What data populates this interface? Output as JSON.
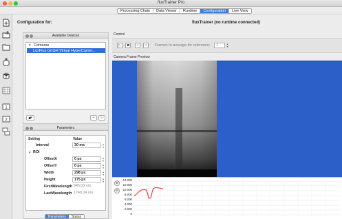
{
  "window": {
    "title": "fluxTrainer Pro"
  },
  "tabs": [
    {
      "label": "Processing Chain",
      "active": false
    },
    {
      "label": "Data Viewer",
      "active": false
    },
    {
      "label": "Runtime",
      "active": false
    },
    {
      "label": "Configuration",
      "active": true
    },
    {
      "label": "Live View",
      "active": false
    }
  ],
  "config": {
    "label": "Configuration for:",
    "connection": "fluxTrainer (no runtime connected)"
  },
  "devices_panel": {
    "title": "Available Devices",
    "tree": {
      "group": "Cameras",
      "item": "LuxFlux GmbH Virtual HyperCamer..."
    }
  },
  "parameters_panel": {
    "title": "Parameters",
    "columns": {
      "setting": "Setting",
      "value": "Value"
    },
    "rows": [
      {
        "name": "Interval",
        "value": "30 ms",
        "editable": true
      },
      {
        "name": "ROI",
        "value": "",
        "group": true
      },
      {
        "name": "OffsetX",
        "value": "0 px",
        "editable": true
      },
      {
        "name": "OffsetY",
        "value": "0 px",
        "editable": true
      },
      {
        "name": "Width",
        "value": "298 px",
        "editable": true
      },
      {
        "name": "Height",
        "value": "175 px",
        "editable": true
      },
      {
        "name": "FirstWavelength",
        "value": "945,03 nm",
        "editable": false
      },
      {
        "name": "LastWavelength",
        "value": "1740,34 nm",
        "editable": false
      }
    ],
    "segments": [
      {
        "label": "Parameters",
        "active": true
      },
      {
        "label": "Status",
        "active": false
      }
    ]
  },
  "control": {
    "label": "Control",
    "frames_label": "Frames to average for reference:",
    "frames_value": "1"
  },
  "preview": {
    "label": "Camera Frame Preview"
  },
  "chart_data": {
    "type": "line",
    "y_ticks": [
      "14.000",
      "12.000",
      "10.000",
      "8.000",
      "6.000",
      "4.000",
      "2.000",
      "0"
    ],
    "ylim": [
      0,
      14000
    ],
    "x": [
      0,
      10,
      20,
      30,
      40,
      50,
      55,
      60,
      65,
      70,
      75,
      80,
      90,
      100,
      110,
      120
    ],
    "series": [
      {
        "values": [
          7800,
          8700,
          9600,
          10300,
          10500,
          10300,
          9200,
          7000,
          6900,
          7400,
          9700,
          11000,
          11300,
          11200,
          11000,
          10800
        ]
      }
    ],
    "line_color": "#e8332a",
    "grid": true
  },
  "colors": {
    "accent": "#3d7fe0",
    "preview_bg": "#2c5fc7"
  }
}
